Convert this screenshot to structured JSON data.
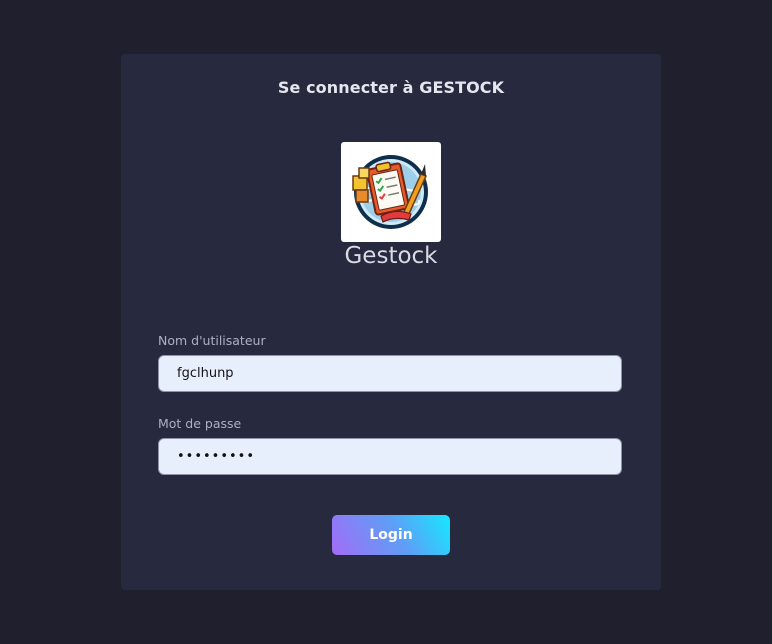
{
  "page": {
    "background_color": "#1f1f2e",
    "card_color": "#272a3e",
    "accent_gradient": [
      "#a36cf6",
      "#16e8ff"
    ]
  },
  "login": {
    "title": "Se connecter à GESTOCK",
    "app_name": "Gestock",
    "logo_icon": "clipboard-checklist-icon",
    "username": {
      "label": "Nom d'utilisateur",
      "value": "fgclhunp"
    },
    "password": {
      "label": "Mot de passe",
      "value": "•••••••••"
    },
    "submit_label": "Login"
  }
}
